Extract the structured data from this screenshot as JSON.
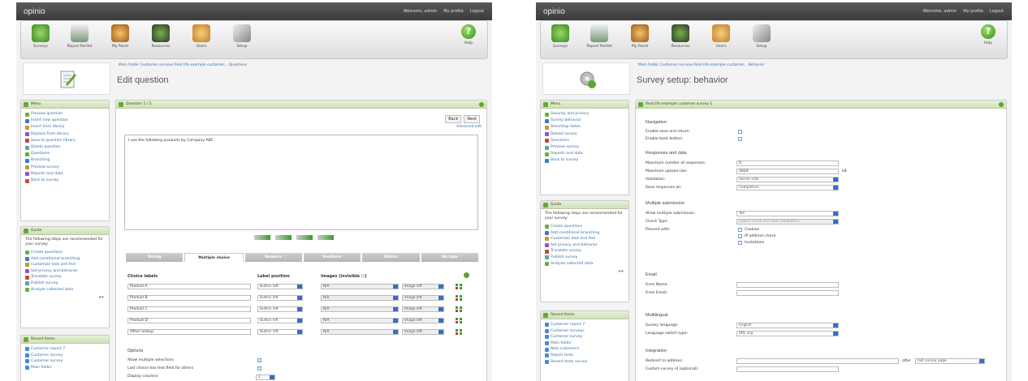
{
  "left": {
    "logo": "opinio",
    "top_links": [
      "Welcome, admin",
      "My profile",
      "Logout"
    ],
    "toolbar": [
      "Surveys",
      "Report Portlet",
      "My Panel",
      "Resources",
      "Users",
      "Setup"
    ],
    "help": "Help",
    "breadcrumb": "Main folder  Customer surveys  Real life example customer...  Questions",
    "title": "Edit question",
    "menu": {
      "title": "Menu",
      "items": [
        "Preview question",
        "Insert new question",
        "Insert from library",
        "Replace from library",
        "Save to question library",
        "Delete question",
        "Questions",
        "Branching",
        "Preview survey",
        "Reports and data",
        "Back to survey"
      ]
    },
    "guide": {
      "title": "Guide",
      "intro": "The following steps are recommended for your survey:",
      "items": [
        "Create questions",
        "Add conditional branching",
        "Customize look and feel",
        "Set privacy and behavior",
        "Translate survey",
        "Publish survey",
        "Analyze collected data"
      ],
      "more": "»»"
    },
    "recent": {
      "title": "Recent Items",
      "items": [
        "Customer report 7",
        "Customer survey",
        "Customer survey",
        "Main folder"
      ]
    },
    "question": {
      "header": "Question 1 / 5",
      "back": "Back",
      "next": "Next",
      "advanced": "Advanced edit",
      "text": "I use the following products by Company ABC",
      "tabs": [
        "Rating",
        "Multiple choice",
        "Numeric",
        "Freeform",
        "Matrix",
        "No type"
      ],
      "col_headers": [
        "Choice labels",
        "Label position",
        "Images (invisible ☐)"
      ],
      "choices": [
        "Product A",
        "Product B",
        "Product C",
        "Product D",
        "Other lookup"
      ],
      "label_position": "Button left",
      "image_value": "N/A",
      "image_select": "Image left",
      "options_title": "Options",
      "options": [
        "Allow multiple selections",
        "Last choice has text field for others",
        "Display columns"
      ],
      "display_columns": "2"
    }
  },
  "right": {
    "logo": "opinio",
    "top_links": [
      "Welcome, admin",
      "My profile",
      "Logout"
    ],
    "toolbar": [
      "Surveys",
      "Report Portlet",
      "My Panel",
      "Resources",
      "Users",
      "Setup"
    ],
    "help": "Help",
    "breadcrumb": "Main folder  Customer surveys  Real life example customer...  Behavior",
    "title": "Survey setup: behavior",
    "menu": {
      "title": "Menu",
      "items": [
        "Security and privacy",
        "Survey behavior",
        "Start/stop dates",
        "Reload survey",
        "Questions",
        "Preview survey",
        "Reports and data",
        "Back to survey"
      ]
    },
    "guide": {
      "title": "Guide",
      "intro": "The following steps are recommended for your survey:",
      "items": [
        "Create questions",
        "Add conditional branching",
        "Customize look and feel",
        "Set privacy and behavior",
        "Translate survey",
        "Publish survey",
        "Analyze collected data"
      ],
      "more": "»»"
    },
    "recent": {
      "title": "Recent Items",
      "items": [
        "Customer report 7",
        "Customer surveys",
        "Customer survey",
        "Main folder",
        "New customers",
        "Report tests",
        "Recent tests survey"
      ]
    },
    "form": {
      "header": "Real life example customer survey 1",
      "sections": {
        "navigation": "Navigation",
        "responses": "Responses and data",
        "multiple": "Multiple submission",
        "email": "Email",
        "multilingual": "Multilingual",
        "integration": "Integration"
      },
      "nav_fields": [
        "Enable save and return:",
        "Enable back button:"
      ],
      "resp_fields": [
        "Maximum number of responses:",
        "Maximum upload size:",
        "Validation:",
        "Save responses on:"
      ],
      "resp_values": [
        "0",
        "1024",
        "Server side",
        "Completion"
      ],
      "upload_unit": "kB",
      "multi_fields": [
        "Allow multiple submission:",
        "Check Type:",
        "Prevent with:"
      ],
      "multi_values": [
        "Yes",
        "Cookie check and later completion"
      ],
      "prevent_options": [
        "Cookies",
        "IP address check",
        "Invitations"
      ],
      "email_fields": [
        "From Name:",
        "From Email:"
      ],
      "ml_fields": [
        "Survey language:",
        "Language switch type:"
      ],
      "ml_values": [
        "English",
        "URL arg"
      ],
      "int_fields": [
        "Redirect to address:",
        "Custom survey id (optional):"
      ],
      "after_label": "after",
      "after_value": "last survey page"
    }
  }
}
